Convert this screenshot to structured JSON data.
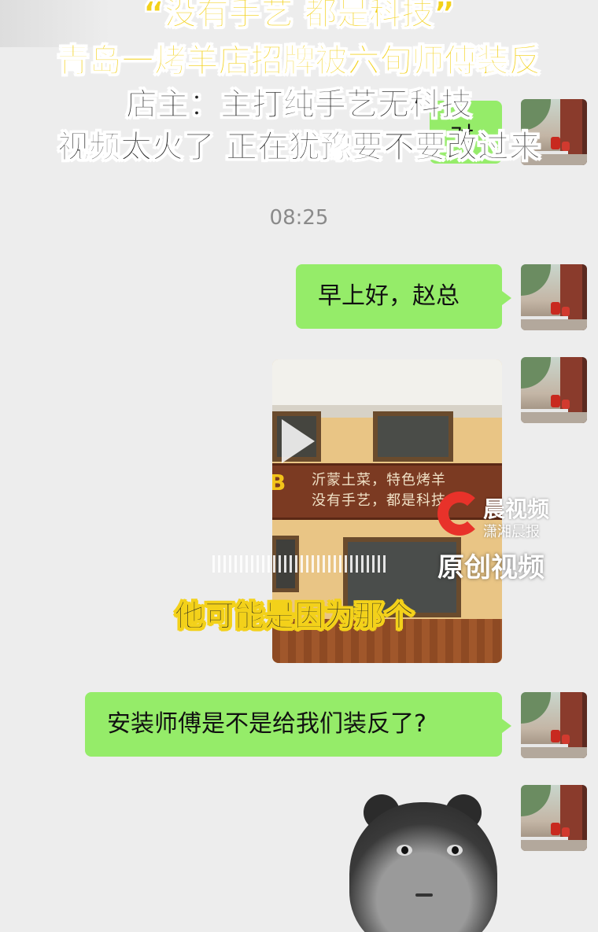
{
  "overlay_headline": {
    "line1": "“没有手艺 都是科技”",
    "line2": "青岛一烤羊店招牌被六旬师傅装反",
    "line3": "店主：主打纯手艺无科技",
    "line4": "视频太火了 正在犹豫要不要改过来"
  },
  "chat": {
    "timestamp": "08:25",
    "messages": [
      {
        "type": "text",
        "sender": "me",
        "text": "早上好，赵总"
      },
      {
        "type": "video",
        "sender": "me",
        "sign_line1": "沂蒙土菜，特色烤羊",
        "sign_line2": "没有手艺，都是科技",
        "subtitle": "他可能是因为那个",
        "watermark_name": "晨视频",
        "watermark_sub": "潇湘晨报",
        "watermark_original": "原创视频"
      },
      {
        "type": "text",
        "sender": "me",
        "text": "安装师傅是不是给我们装反了?"
      },
      {
        "type": "sticker",
        "sender": "me"
      }
    ],
    "partial_top_bubble": "对"
  },
  "colors": {
    "bubble_green": "#95ec69",
    "background": "#ededed",
    "headline_yellow": "#f3d11a",
    "watermark_red": "#e8322a"
  }
}
